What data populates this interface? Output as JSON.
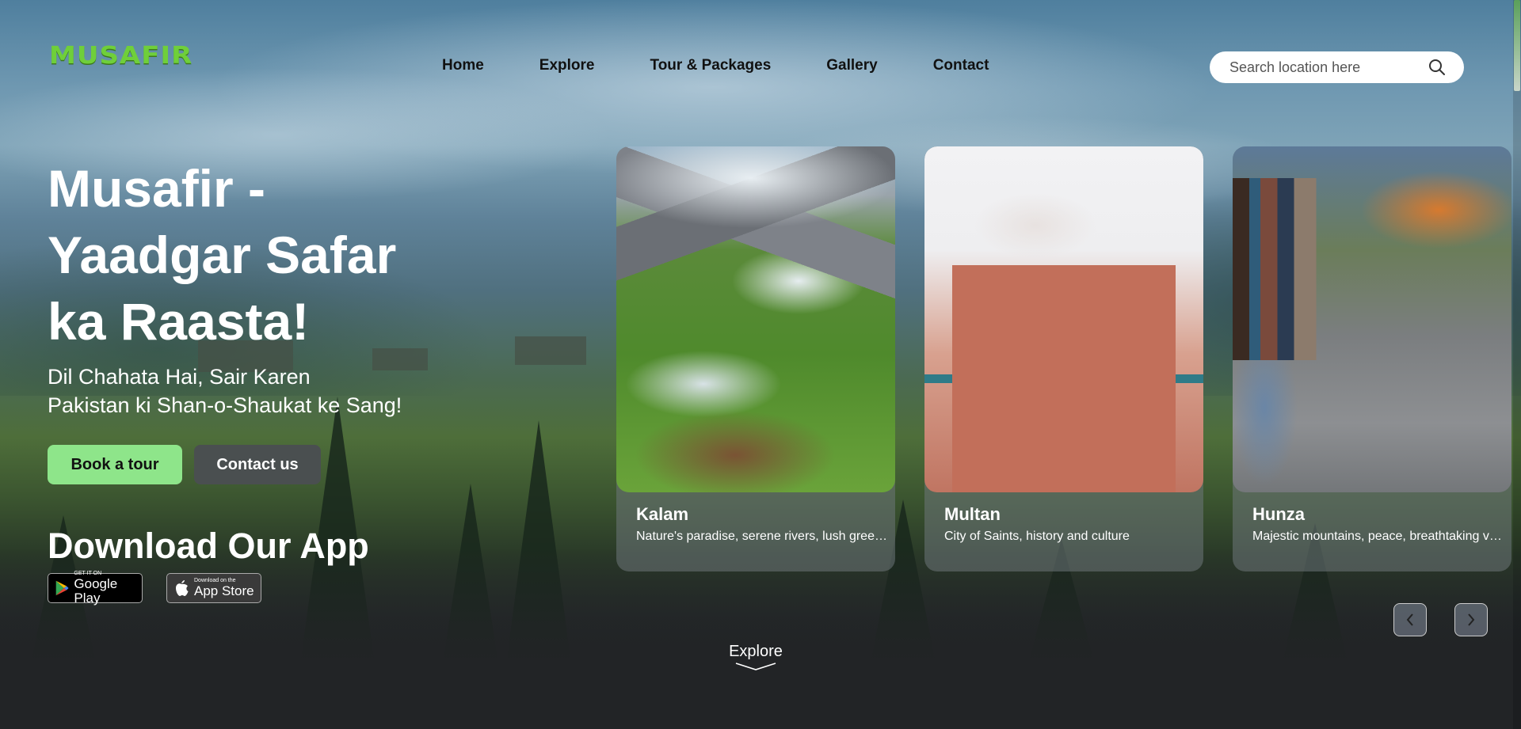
{
  "brand": {
    "logo_text": "MUSAFIR"
  },
  "nav": {
    "items": [
      {
        "label": "Home"
      },
      {
        "label": "Explore"
      },
      {
        "label": "Tour & Packages"
      },
      {
        "label": "Gallery"
      },
      {
        "label": "Contact"
      }
    ]
  },
  "search": {
    "placeholder": "Search location here",
    "icon": "search-icon"
  },
  "hero": {
    "title": "Musafir - Yaadgar Safar ka Raasta!",
    "subtitle_line1": "Dil Chahata Hai, Sair Karen",
    "subtitle_line2": "Pakistan ki Shan-o-Shaukat ke Sang!",
    "primary_button": "Book a tour",
    "secondary_button": "Contact us"
  },
  "app": {
    "title": "Download Our App",
    "google_play": {
      "small": "GET IT ON",
      "big": "Google Play"
    },
    "app_store": {
      "small": "Download on the",
      "big": "App Store"
    }
  },
  "cards": [
    {
      "name": "Kalam",
      "desc": "Nature's paradise, serene rivers, lush greenery"
    },
    {
      "name": "Multan",
      "desc": "City of Saints, history and culture"
    },
    {
      "name": "Hunza",
      "desc": "Majestic mountains, peace, breathtaking views"
    }
  ],
  "carousel": {
    "prev_icon": "chevron-left-icon",
    "next_icon": "chevron-right-icon"
  },
  "explore_link": {
    "label": "Explore",
    "icon": "chevron-down-icon"
  },
  "colors": {
    "accent": "#8ee58a",
    "logo": "#6fcf3a",
    "secondary_button": "#4a4f50"
  }
}
